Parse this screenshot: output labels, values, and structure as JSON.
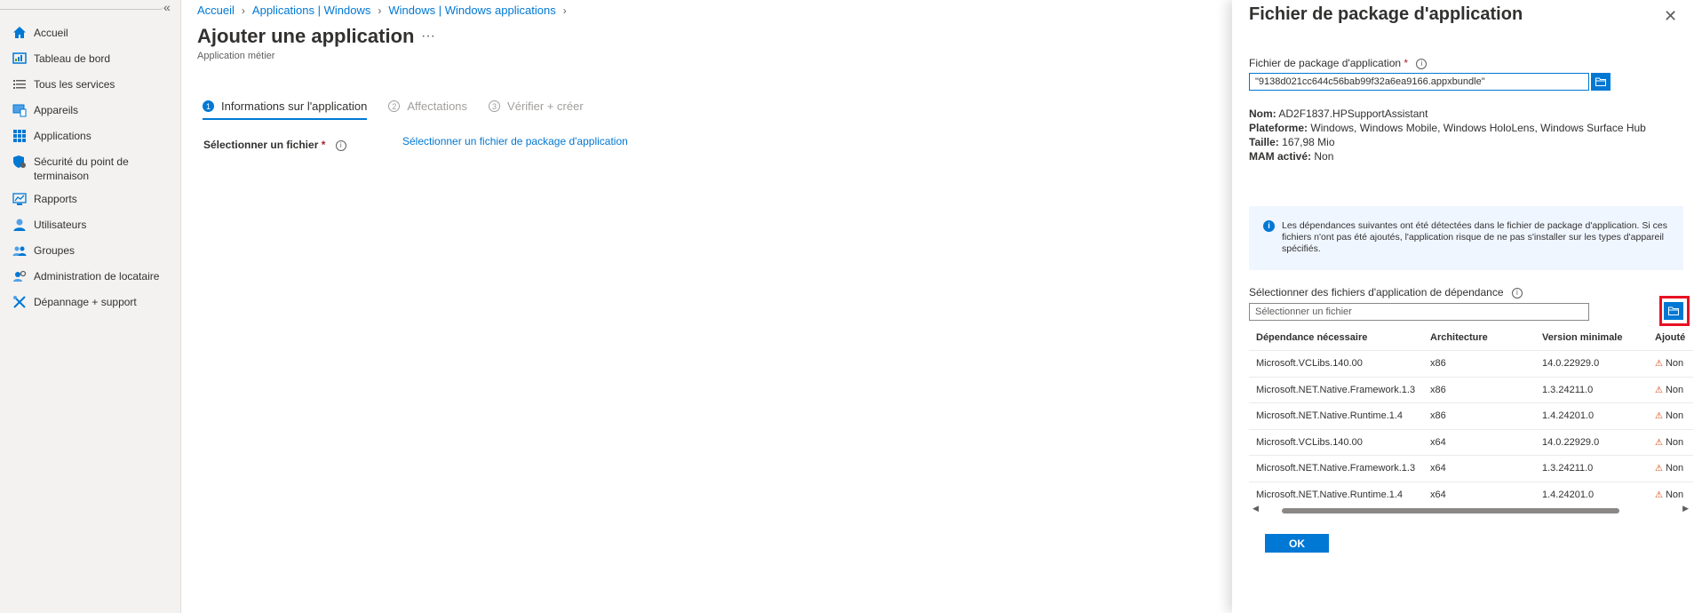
{
  "sidebar": {
    "collapse_label": "«",
    "items": [
      {
        "label": "Accueil",
        "icon": "home-icon"
      },
      {
        "label": "Tableau de bord",
        "icon": "dashboard-icon"
      },
      {
        "label": "Tous les services",
        "icon": "list-icon"
      },
      {
        "label": "Appareils",
        "icon": "devices-icon"
      },
      {
        "label": "Applications",
        "icon": "apps-grid-icon"
      },
      {
        "label": "Sécurité du point de terminaison",
        "icon": "shield-icon"
      },
      {
        "label": "Rapports",
        "icon": "reports-icon"
      },
      {
        "label": "Utilisateurs",
        "icon": "user-icon"
      },
      {
        "label": "Groupes",
        "icon": "groups-icon"
      },
      {
        "label": "Administration de locataire",
        "icon": "tenant-admin-icon"
      },
      {
        "label": "Dépannage + support",
        "icon": "troubleshoot-icon"
      }
    ]
  },
  "breadcrumb": [
    "Accueil",
    "Applications | Windows",
    "Windows | Windows applications"
  ],
  "page": {
    "title": "Ajouter une application",
    "ellipsis": "···",
    "subtitle": "Application métier"
  },
  "steps": [
    {
      "num": "1",
      "label": "Informations sur l'application",
      "active": true
    },
    {
      "num": "2",
      "label": "Affectations",
      "active": false
    },
    {
      "num": "3",
      "label": "Vérifier + créer",
      "active": false
    }
  ],
  "form": {
    "select_file_label": "Sélectionner un fichier",
    "required_mark": "*",
    "select_file_link": "Sélectionner un fichier de package d'application"
  },
  "panel": {
    "title": "Fichier de package d'application",
    "close": "✕",
    "pkg_label": "Fichier de package d'application",
    "pkg_value": "\"9138d021cc644c56bab99f32a6ea9166.appxbundle\"",
    "props": [
      {
        "key": "Nom:",
        "value": "AD2F1837.HPSupportAssistant"
      },
      {
        "key": "Plateforme:",
        "value": "Windows, Windows Mobile, Windows HoloLens, Windows Surface Hub"
      },
      {
        "key": "Taille:",
        "value": "167,98 Mio"
      },
      {
        "key": "MAM activé:",
        "value": "Non"
      }
    ],
    "info_text": "Les dépendances suivantes ont été détectées dans le fichier de package d'application. Si ces fichiers n'ont pas été ajoutés, l'application risque de ne pas s'installer sur les types d'appareil spécifiés.",
    "dep_label": "Sélectionner des fichiers d'application de dépendance",
    "dep_placeholder": "Sélectionner un fichier",
    "table": {
      "headers": [
        "Dépendance nécessaire",
        "Architecture",
        "Version minimale",
        "Ajouté"
      ],
      "rows": [
        [
          "Microsoft.VCLibs.140.00",
          "x86",
          "14.0.22929.0",
          "Non"
        ],
        [
          "Microsoft.NET.Native.Framework.1.3",
          "x86",
          "1.3.24211.0",
          "Non"
        ],
        [
          "Microsoft.NET.Native.Runtime.1.4",
          "x86",
          "1.4.24201.0",
          "Non"
        ],
        [
          "Microsoft.VCLibs.140.00",
          "x64",
          "14.0.22929.0",
          "Non"
        ],
        [
          "Microsoft.NET.Native.Framework.1.3",
          "x64",
          "1.3.24211.0",
          "Non"
        ],
        [
          "Microsoft.NET.Native.Runtime.1.4",
          "x64",
          "1.4.24201.0",
          "Non"
        ]
      ]
    },
    "ok_label": "OK"
  },
  "colors": {
    "accent": "#0078d4",
    "highlight": "#e81123",
    "warning": "#d83b01"
  }
}
